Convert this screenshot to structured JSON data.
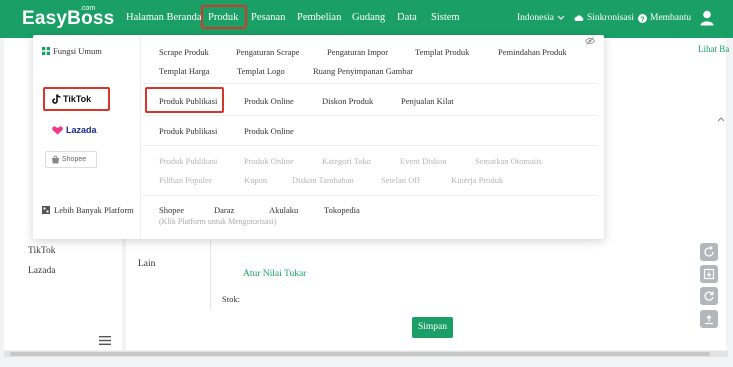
{
  "app": {
    "logo": "EasyBoss",
    "logo_suffix": ".com"
  },
  "nav": {
    "items": [
      "Halaman Beranda",
      "Produk",
      "Pesanan",
      "Pembelian",
      "Gudang",
      "Data",
      "Sistem"
    ],
    "language": "Indonesia",
    "sync": "Sinkronisasi",
    "help": "Membantu"
  },
  "dropdown": {
    "general_label": "Fungsi Umum",
    "more_platforms": "Lebih Banyak Platform",
    "platforms": [
      "TikTok",
      "Lazada",
      "Shopee"
    ],
    "general_row1": [
      "Scrape Produk",
      "Pengaturan Scrape",
      "Pengaturan Impor",
      "Templat Produk",
      "Pemindahan Produk"
    ],
    "general_row2": [
      "Templat Harga",
      "Templat Logo",
      "Ruang Penyimpanan Gambar"
    ],
    "tiktok_row": [
      "Produk Publikasi",
      "Produk Online",
      "Diskon Produk",
      "Penjualan Kilat"
    ],
    "lazada_row": [
      "Produk Publikasi",
      "Produk Online"
    ],
    "shopee_row1": [
      "Produk Publikasi",
      "Produk Online",
      "Kategori Toko",
      "Event Diskon",
      "Sematkan Otomatis"
    ],
    "shopee_row2": [
      "Pilihan Populer",
      "Kupon",
      "Diskon Tambahan",
      "Setelan Off",
      "Kinerja Produk"
    ],
    "more_row": [
      "Shopee",
      "Daraz",
      "Akulaku",
      "Tokopedia"
    ],
    "more_note": "(Klik Platform untuk Mengotorisasi)"
  },
  "background": {
    "sidebar_items": [
      "TikTok",
      "Lazada"
    ],
    "lihat": "Lihat Ba",
    "lain": "Lain",
    "atur": "Atur Nilai Tukar",
    "stok": "Stok:",
    "save": "Simpan"
  },
  "colors": {
    "brand": "#1aa066",
    "highlight": "#d9362a"
  }
}
